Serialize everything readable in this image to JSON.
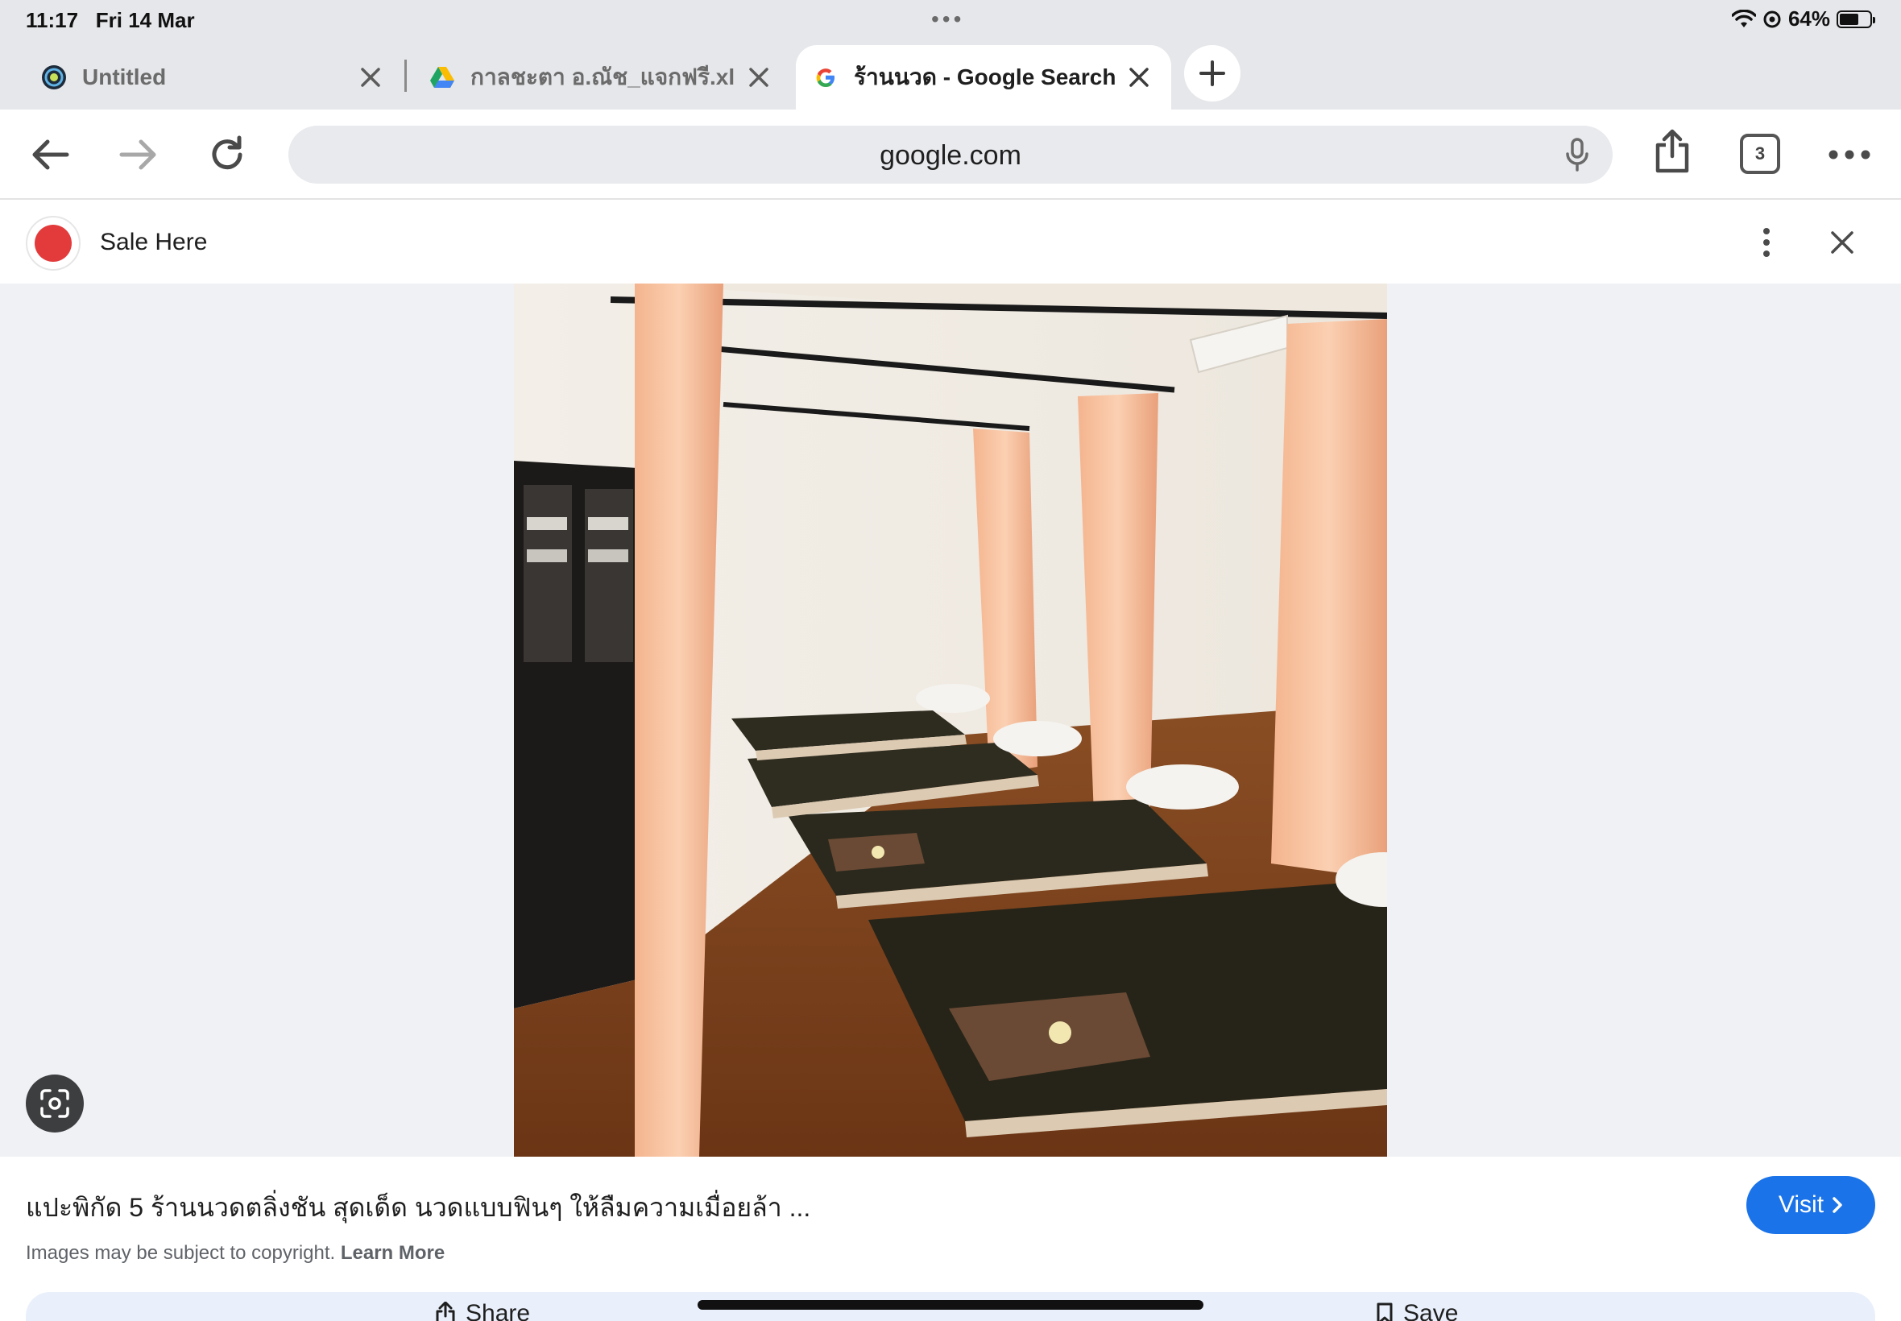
{
  "status": {
    "time": "11:17",
    "date": "Fri 14 Mar",
    "battery": "64%",
    "battery_level": 0.64,
    "icons": [
      "wifi-icon",
      "at-sign-icon",
      "battery-icon"
    ]
  },
  "tabs": [
    {
      "title": "Untitled",
      "favicon": "swirl-icon",
      "active": false
    },
    {
      "title": "กาลชะตา อ.ณัช_แจกฟรี.xl",
      "favicon": "google-drive-icon",
      "active": false
    },
    {
      "title": "ร้านนวด - Google Search",
      "favicon": "google-g-icon",
      "active": true
    }
  ],
  "toolbar": {
    "url": "google.com",
    "tab_count": "3"
  },
  "viewer": {
    "source_name": "Sale Here"
  },
  "result": {
    "title": "แปะพิกัด 5 ร้านนวดตลิ่งชัน สุดเด็ด นวดแบบฟินๆ ให้ลืมความเมื่อยล้า ...",
    "visit_label": "Visit",
    "copyright_text": "Images may be subject to copyright.",
    "learn_more": "Learn More",
    "share_label": "Share",
    "save_label": "Save"
  },
  "colors": {
    "accent": "#1a73e8",
    "chrome_bg": "#e6e7ea",
    "stage_bg": "#f0f1f4"
  }
}
